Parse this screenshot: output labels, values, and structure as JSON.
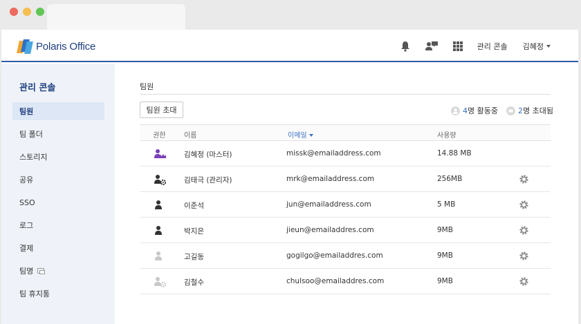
{
  "app": {
    "brand": "Polaris Office",
    "header": {
      "admin_console_link": "관리 콘솔",
      "user_name": "김혜정",
      "icons": [
        "bell-icon",
        "team-chat-icon",
        "apps-grid-icon"
      ]
    }
  },
  "sidebar": {
    "title": "관리 콘솔",
    "items": [
      {
        "label": "팀원",
        "active": true
      },
      {
        "label": "팀 폴더",
        "active": false
      },
      {
        "label": "스토리지",
        "active": false
      },
      {
        "label": "공유",
        "active": false
      },
      {
        "label": "SSO",
        "active": false
      },
      {
        "label": "로그",
        "active": false
      },
      {
        "label": "결제",
        "active": false
      },
      {
        "label": "팀명",
        "active": false
      },
      {
        "label": "팀 휴지통",
        "active": false
      }
    ]
  },
  "main": {
    "title": "팀원",
    "invite_button": "팀원 초대",
    "stats": {
      "active_count": "4",
      "active_label": "명 활동중",
      "invited_count": "2",
      "invited_label": "명 초대됨"
    },
    "table": {
      "headers": {
        "role": "권한",
        "name": "이름",
        "email": "이메일",
        "usage": "사용량"
      },
      "sorted_column": "email",
      "rows": [
        {
          "role": "master",
          "name": "김혜정 (마스터)",
          "email": "missk@emailaddress.com",
          "usage": "14.88 MB",
          "settings": false
        },
        {
          "role": "admin",
          "name": "김태극 (관리자)",
          "email": "mrk@emailaddress.com",
          "usage": "256MB",
          "settings": true
        },
        {
          "role": "member",
          "name": "이준석",
          "email": "jun@emailaddress.com",
          "usage": "5 MB",
          "settings": true
        },
        {
          "role": "member",
          "name": "박지은",
          "email": "jieun@emailaddres.com",
          "usage": "9MB",
          "settings": true
        },
        {
          "role": "inactive-member",
          "name": "고길동",
          "email": "gogilgo@emailaddres.com",
          "usage": "9MB",
          "settings": true
        },
        {
          "role": "inactive-admin",
          "name": "김철수",
          "email": "chulsoo@emailaddres.com",
          "usage": "9MB",
          "settings": true
        }
      ]
    }
  },
  "colors": {
    "accent": "#2f5aa6",
    "link": "#3a6fc4",
    "sidebar_bg": "#eff3f9",
    "master_icon": "#7b3fb8"
  }
}
